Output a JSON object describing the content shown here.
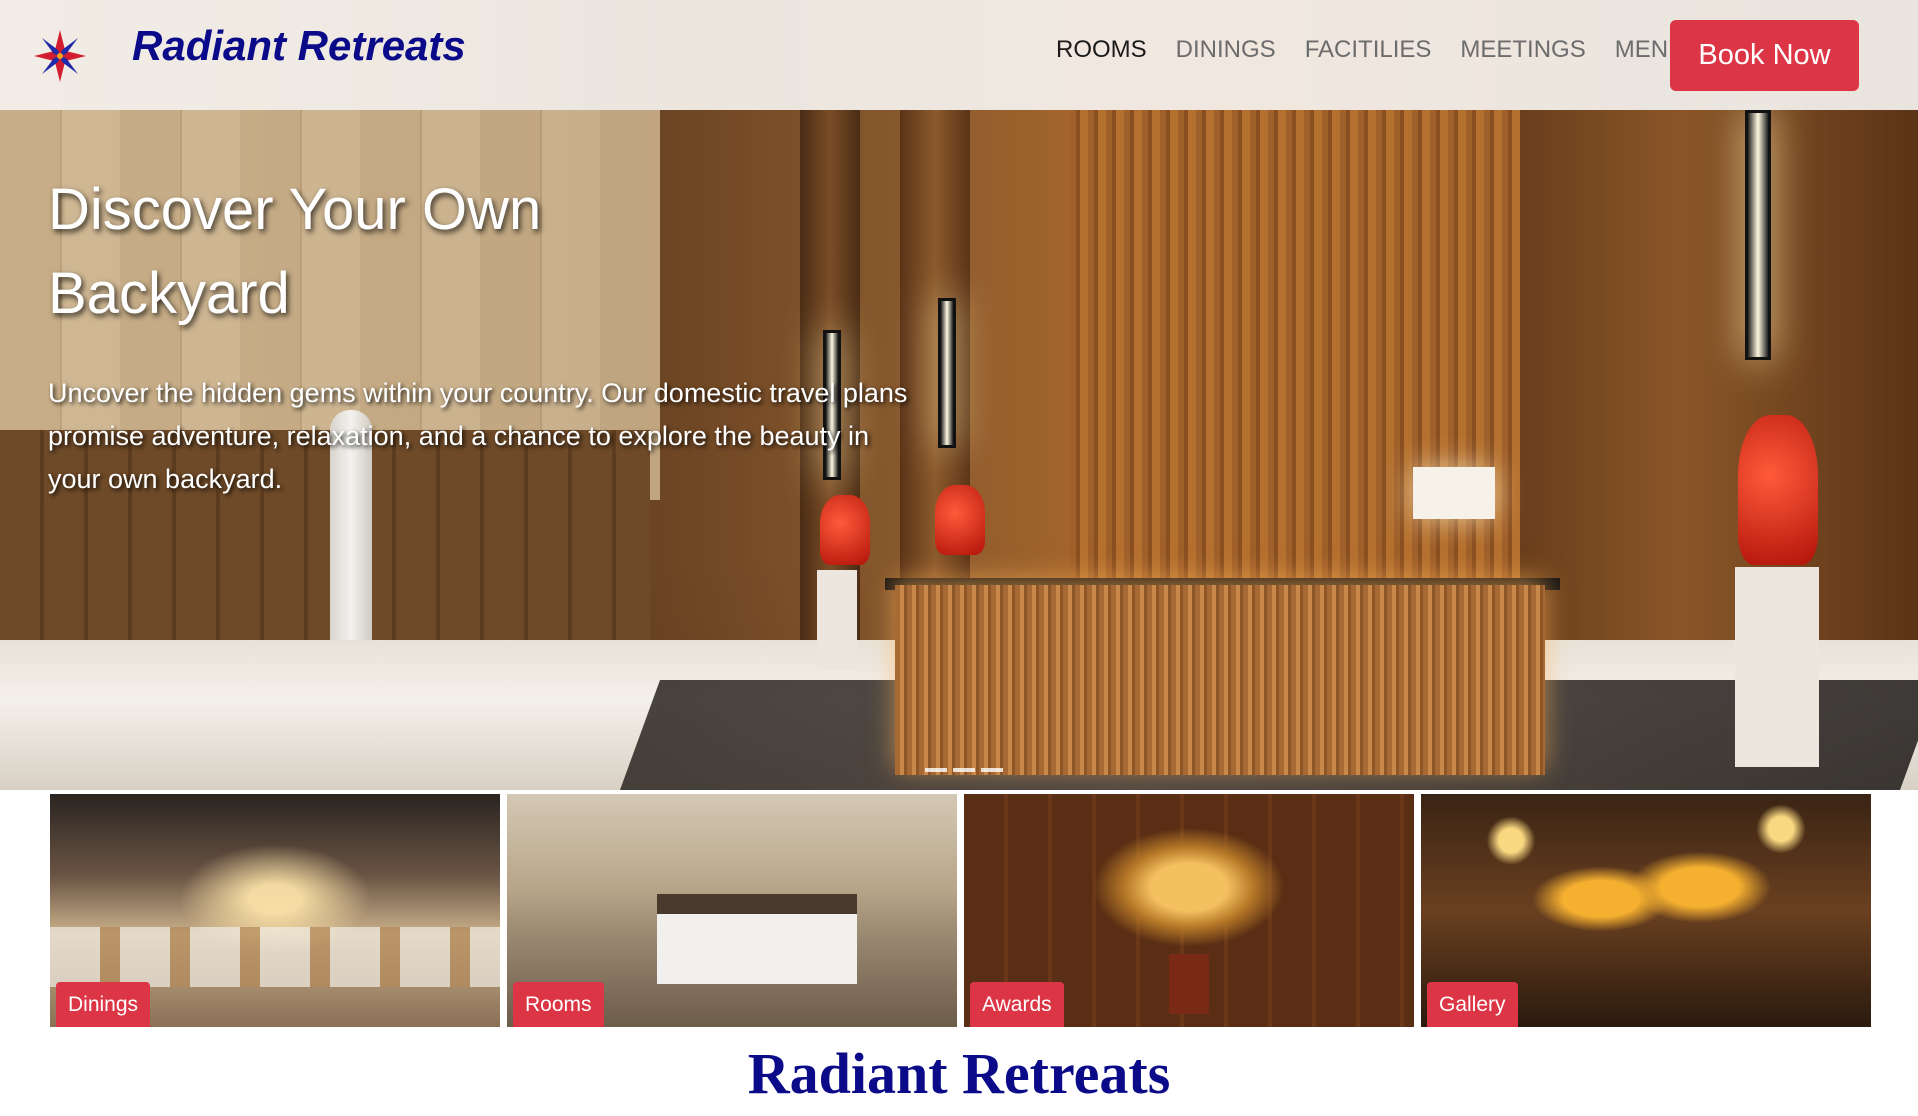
{
  "brand": {
    "name": "Radiant Retreats"
  },
  "nav": {
    "links": [
      {
        "label": "ROOMS",
        "active": true
      },
      {
        "label": "DININGS",
        "active": false
      },
      {
        "label": "FACITILIES",
        "active": false
      },
      {
        "label": "MEETINGS",
        "active": false
      },
      {
        "label": "MENU",
        "active": false
      }
    ],
    "book_label": "Book Now"
  },
  "hero": {
    "title": "Discover Your Own Backyard",
    "text": "Uncover the hidden gems within your country. Our domestic travel plans promise adventure, relaxation, and a chance to explore the beauty in your own backyard.",
    "slide_count": 3
  },
  "cards": [
    {
      "label": "Dinings"
    },
    {
      "label": "Rooms"
    },
    {
      "label": "Awards"
    },
    {
      "label": "Gallery"
    }
  ],
  "footer": {
    "title": "Radiant Retreats"
  },
  "colors": {
    "accent": "#dc3545",
    "brand": "#0b0b8a"
  }
}
